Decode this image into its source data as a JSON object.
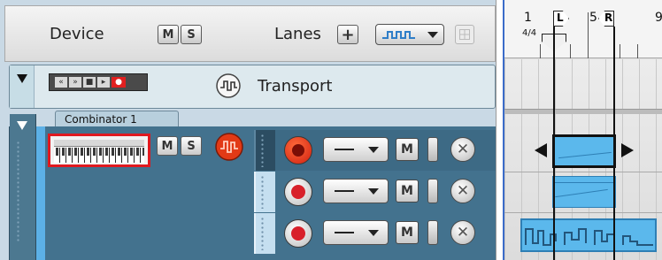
{
  "header": {
    "device_label": "Device",
    "mute_label": "M",
    "solo_label": "S",
    "lanes_label": "Lanes",
    "add_lane_label": "+"
  },
  "transport_track": {
    "name": "Transport",
    "transport_buttons": [
      "«",
      "»",
      "■",
      "▸",
      "●"
    ]
  },
  "combinator_track": {
    "name": "Combinator 1",
    "mute_label": "M",
    "solo_label": "S",
    "lanes": [
      {
        "record_armed": true,
        "mute_label": "M",
        "delete_label": "✕"
      },
      {
        "record_armed": false,
        "mute_label": "M",
        "delete_label": "✕"
      },
      {
        "record_armed": false,
        "mute_label": "M",
        "delete_label": "✕"
      }
    ]
  },
  "ruler": {
    "bar_1": "1",
    "time_signature": "4/4",
    "bar_5": "5",
    "bar_9": "9",
    "left_locator": "L",
    "right_locator": "R"
  },
  "colors": {
    "panel_bg": "#c9d9e5",
    "track_bg": "#43728e",
    "clip_fill": "#58b6ea",
    "record_red": "#d8202a"
  },
  "icons": {
    "lane_select": "automation-wave-icon",
    "transport_device": "wave-icon"
  }
}
